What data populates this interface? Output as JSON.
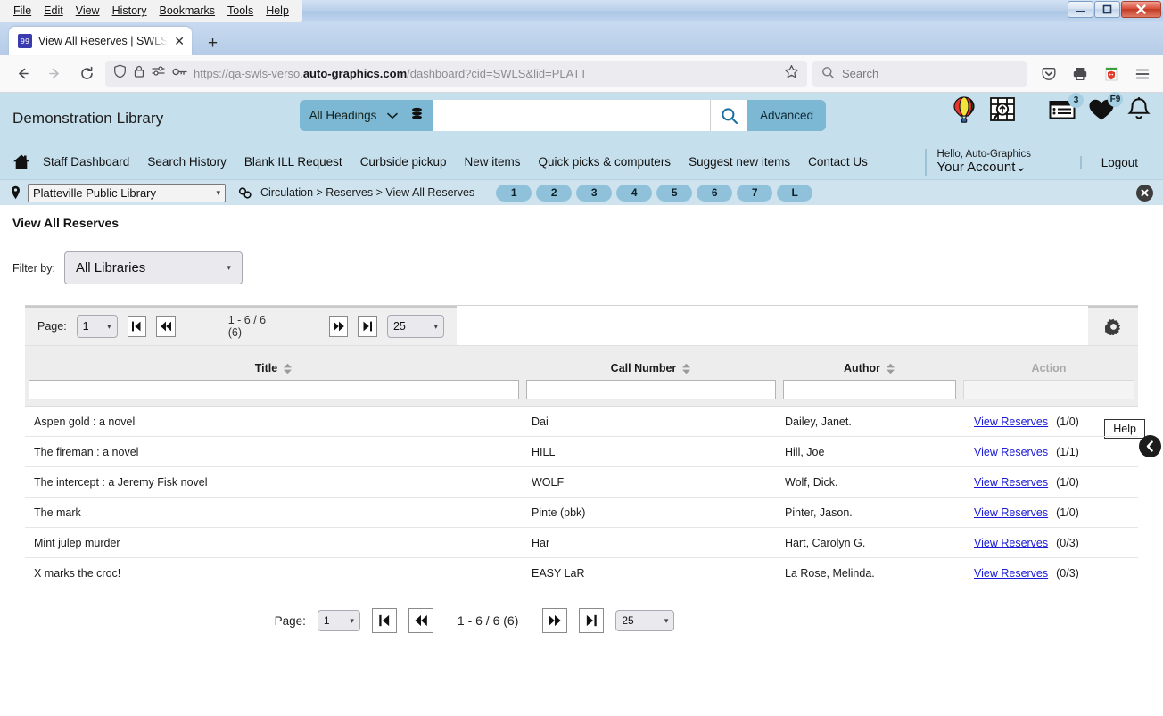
{
  "browser": {
    "menus": [
      "File",
      "Edit",
      "View",
      "History",
      "Bookmarks",
      "Tools",
      "Help"
    ],
    "window_controls": {
      "minimize": "–",
      "maximize": "❐",
      "close": "✕"
    },
    "tab": {
      "title": "View All Reserves | SWLS | PLATT",
      "close": "✕",
      "new_tab": "+"
    },
    "url": {
      "prefix": "https://qa-swls-verso.",
      "domain": "auto-graphics.com",
      "path": "/dashboard?cid=SWLS&lid=PLATT"
    },
    "search_placeholder": "Search"
  },
  "header": {
    "library_name": "Demonstration Library",
    "headings_label": "All Headings",
    "search_value": "",
    "advanced_label": "Advanced",
    "notifications_count": "3",
    "favorites_badge": "F9"
  },
  "nav": {
    "links": [
      "Staff Dashboard",
      "Search History",
      "Blank ILL Request",
      "Curbside pickup",
      "New items",
      "Quick picks & computers",
      "Suggest new items",
      "Contact Us"
    ],
    "hello": "Hello, Auto-Graphics",
    "your_account": "Your Account",
    "logout": "Logout"
  },
  "breadcrumb": {
    "library_select": "Platteville Public Library",
    "trail": "Circulation > Reserves > View All Reserves",
    "pills": [
      "1",
      "2",
      "3",
      "4",
      "5",
      "6",
      "7",
      "L"
    ],
    "close": "✕"
  },
  "page": {
    "title": "View All Reserves",
    "help_label": "Help",
    "filter_label": "Filter by:",
    "filter_value": "All Libraries"
  },
  "toolbar": {
    "page_label": "Page:",
    "page_value": "1",
    "count_text": "1 - 6 / 6 (6)",
    "page_size": "25"
  },
  "bottom_pager": {
    "page_label": "Page:",
    "page_value": "1",
    "count_text": "1 - 6 / 6 (6)",
    "page_size": "25"
  },
  "grid": {
    "columns": [
      "Title",
      "Call Number",
      "Author",
      "Action"
    ],
    "filters": [
      "",
      "",
      "",
      ""
    ],
    "action_label": "View Reserves",
    "rows": [
      {
        "title": "Aspen gold : a novel",
        "call": "Dai",
        "author": "Dailey, Janet.",
        "action": "View Reserves",
        "count": "(1/0)"
      },
      {
        "title": "The fireman : a novel",
        "call": "HILL",
        "author": "Hill, Joe",
        "action": "View Reserves",
        "count": "(1/1)"
      },
      {
        "title": "The intercept : a Jeremy Fisk novel",
        "call": "WOLF",
        "author": "Wolf, Dick.",
        "action": "View Reserves",
        "count": "(1/0)"
      },
      {
        "title": "The mark",
        "call": "Pinte (pbk)",
        "author": "Pinter, Jason.",
        "action": "View Reserves",
        "count": "(1/0)"
      },
      {
        "title": "Mint julep murder",
        "call": "Har",
        "author": "Hart, Carolyn G.",
        "action": "View Reserves",
        "count": "(0/3)"
      },
      {
        "title": "X marks the croc!",
        "call": "EASY LaR",
        "author": "La Rose, Melinda.",
        "action": "View Reserves",
        "count": "(0/3)"
      }
    ]
  },
  "colors": {
    "header_blue": "#c6dfec",
    "accent_blue": "#7cb7d4",
    "pill_blue": "#8fc2da",
    "link_blue": "#1a1ad6"
  }
}
